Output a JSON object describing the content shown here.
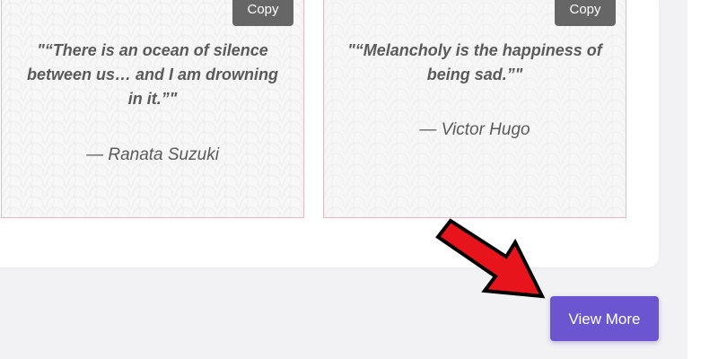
{
  "cards": [
    {
      "copy_label": "Copy",
      "quote": "\"“There is an ocean of silence between us… and I am drowning in it.”\"",
      "author": "— Ranata Suzuki"
    },
    {
      "copy_label": "Copy",
      "quote": "\"“Melancholy is the happiness of being sad.”\"",
      "author": "— Victor Hugo"
    }
  ],
  "view_more_label": "View More",
  "annotation": {
    "arrow_icon": "red-arrow-icon",
    "arrow_color": "#e8141c",
    "arrow_outline": "#000000"
  },
  "colors": {
    "button_copy": "#666666",
    "button_view_more": "#6b56cf",
    "card_border": "#e3b9bd",
    "text": "#5a5a5a"
  }
}
